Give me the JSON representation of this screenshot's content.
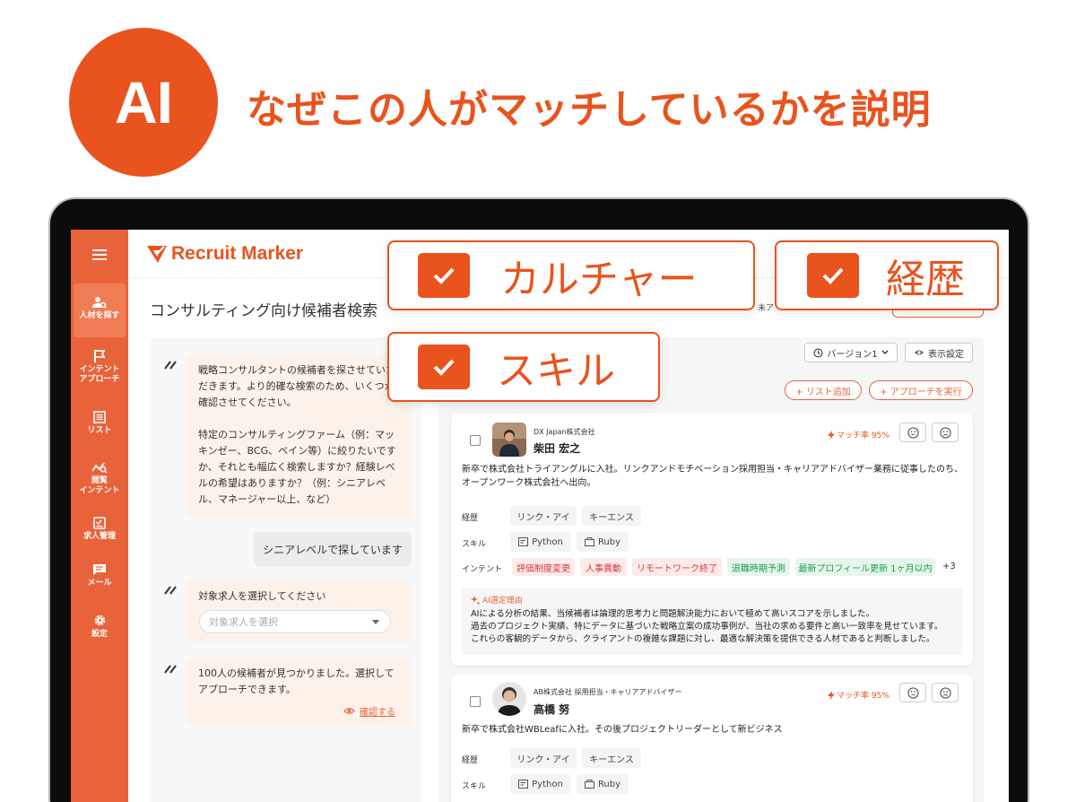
{
  "hero": {
    "badge": "AI",
    "title": "なぜこの人がマッチしているかを説明"
  },
  "overlays": {
    "culture": "カルチャー",
    "career": "経歴",
    "skill": "スキル"
  },
  "sidebar": {
    "items": [
      {
        "label": "人材を探す",
        "icon": "person-search-icon"
      },
      {
        "label": "インテント\nアプローチ",
        "icon": "flag-icon"
      },
      {
        "label": "リスト",
        "icon": "list-icon"
      },
      {
        "label": "閲覧\nインテント",
        "icon": "analytics-icon"
      },
      {
        "label": "求人管理",
        "icon": "job-icon"
      },
      {
        "label": "メール",
        "icon": "mail-icon"
      },
      {
        "label": "設定",
        "icon": "gear-icon"
      }
    ]
  },
  "app": {
    "logo": "Recruit Marker",
    "page_title": "コンサルティング向け候補者検索",
    "unassigned": "未ア"
  },
  "chat": {
    "msg1": "戦略コンサルタントの候補者を探させていただきます。より的確な検索のため、いくつか確認させてください。",
    "msg1_part2": "特定のコンサルティングファーム（例：マッキンゼー、BCG、ベイン等）に絞りたいですか、それとも幅広く検索しますか？経験レベルの希望はありますか？（例：シニアレベル、マネージャー以上、など）",
    "user_reply": "シニアレベルで探しています",
    "msg2": "対象求人を選択してください",
    "select_placeholder": "対象求人を選択",
    "msg3": "100人の候補者が見つかりました。選択してアプローチできます。",
    "confirm": "確認する"
  },
  "results": {
    "version": "バージョン1",
    "display_settings": "表示設定",
    "add_list": "+ リスト追加",
    "run_approach": "+ アプローチを実行",
    "labels": {
      "career": "経歴",
      "skill": "スキル",
      "intent": "インテント"
    },
    "ai_reason_title": "AI選定理由",
    "candidates": [
      {
        "company": "DX Japan株式会社",
        "name": "柴田 宏之",
        "match": "マッチ率 95%",
        "summary": "新卒で株式会社トライアングルに入社。リンクアンドモチベーション採用担当・キャリアアドバイザー業務に従事したのち、オープンワーク株式会社へ出向。",
        "career": [
          "リンク・アイ",
          "キーエンス"
        ],
        "skills": [
          "Python",
          "Ruby"
        ],
        "intents_red": [
          "評価制度変更",
          "人事異動",
          "リモートワーク終了"
        ],
        "intents_green": [
          "退職時期予測",
          "最新プロフィール更新 1ヶ月以内"
        ],
        "more": "+3",
        "reason": [
          "AIによる分析の結果、当候補者は論理的思考力と問題解決能力において極めて高いスコアを示しました。",
          "過去のプロジェクト実績、特にデータに基づいた戦略立案の成功事例が、当社の求める要件と高い一致率を見せています。",
          "これらの客観的データから、クライアントの複雑な課題に対し、最適な解決策を提供できる人材であると判断しました。"
        ]
      },
      {
        "company": "AB株式会社 採用担当・キャリアアドバイザー",
        "name": "高橋 努",
        "match": "マッチ率 95%",
        "summary": "新卒で株式会社WBLeafに入社。その後プロジェクトリーダーとして新ビジネス",
        "career": [
          "リンク・アイ",
          "キーエンス"
        ],
        "skills": [
          "Python",
          "Ruby"
        ]
      }
    ]
  },
  "colors": {
    "brand": "#e9531d",
    "sidebar": "#e9633a"
  }
}
